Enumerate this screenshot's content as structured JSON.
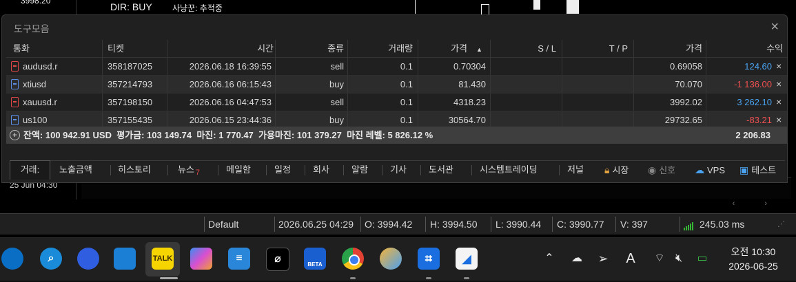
{
  "background": {
    "dir_text": "DIR: BUY",
    "side_text": "사냥꾼: 추적중",
    "price_text": "3998.20",
    "left_time": "25 Jun 04:30"
  },
  "toolbox": {
    "title": "도구모음",
    "columns": [
      "통화",
      "티켓",
      "시간",
      "종류",
      "거래량",
      "가격",
      "S / L",
      "T / P",
      "가격",
      "수익"
    ],
    "rows": [
      {
        "symbol": "audusd.r",
        "ticket": "358187025",
        "time": "2026.06.18 16:39:55",
        "type": "sell",
        "volume": "0.1",
        "price": "0.70304",
        "sl": "",
        "tp": "",
        "current": "0.69058",
        "profit": "124.60",
        "profit_color": "#4aa3f0"
      },
      {
        "symbol": "xtiusd",
        "ticket": "357214793",
        "time": "2026.06.16 06:15:43",
        "type": "buy",
        "volume": "0.1",
        "price": "81.430",
        "sl": "",
        "tp": "",
        "current": "70.070",
        "profit": "-1 136.00",
        "profit_color": "#f05050"
      },
      {
        "symbol": "xauusd.r",
        "ticket": "357198150",
        "time": "2026.06.16 04:47:53",
        "type": "sell",
        "volume": "0.1",
        "price": "4318.23",
        "sl": "",
        "tp": "",
        "current": "3992.02",
        "profit": "3 262.10",
        "profit_color": "#4aa3f0"
      },
      {
        "symbol": "us100",
        "ticket": "357155435",
        "time": "2026.06.15 23:44:36",
        "type": "buy",
        "volume": "0.1",
        "price": "30564.70",
        "sl": "",
        "tp": "",
        "current": "29732.65",
        "profit": "-83.21",
        "profit_color": "#f05050"
      }
    ],
    "summary": {
      "text": "잔액: 100 942.91 USD  평가금: 103 149.74  마진: 1 770.47  가용마진: 101 379.27  마진 레벨: 5 826.12 %",
      "total": "2 206.83"
    },
    "close_glyph": "×",
    "row_close_glyph": "×"
  },
  "tabs": {
    "label": "거래:",
    "items": [
      "노출금액",
      "히스토리",
      "뉴스",
      "메일함",
      "일정",
      "회사",
      "알람",
      "기사",
      "도서관",
      "시스템트레이딩",
      "저널"
    ],
    "news_badge": "7",
    "right_items": [
      "시장",
      "신호",
      "VPS",
      "테스트"
    ]
  },
  "statusbar": {
    "profile": "Default",
    "datetime": "2026.06.25 04:29",
    "open": "O: 3994.42",
    "high": "H: 3994.50",
    "low": "L: 3990.44",
    "close": "C: 3990.77",
    "volume": "V: 397",
    "ping": "245.03 ms"
  },
  "taskbar": {
    "apps": [
      "windows-security",
      "search-app",
      "copilot",
      "file-explorer",
      "kakaotalk",
      "copilot-app",
      "notepad",
      "terminal",
      "beta-app",
      "chrome",
      "paint",
      "snipping-tool",
      "metatrader"
    ],
    "kakao_label": "TALK",
    "beta_label": "BETA",
    "clock_time": "오전 10:30",
    "clock_date": "2026-06-25",
    "tray_a": "A"
  }
}
